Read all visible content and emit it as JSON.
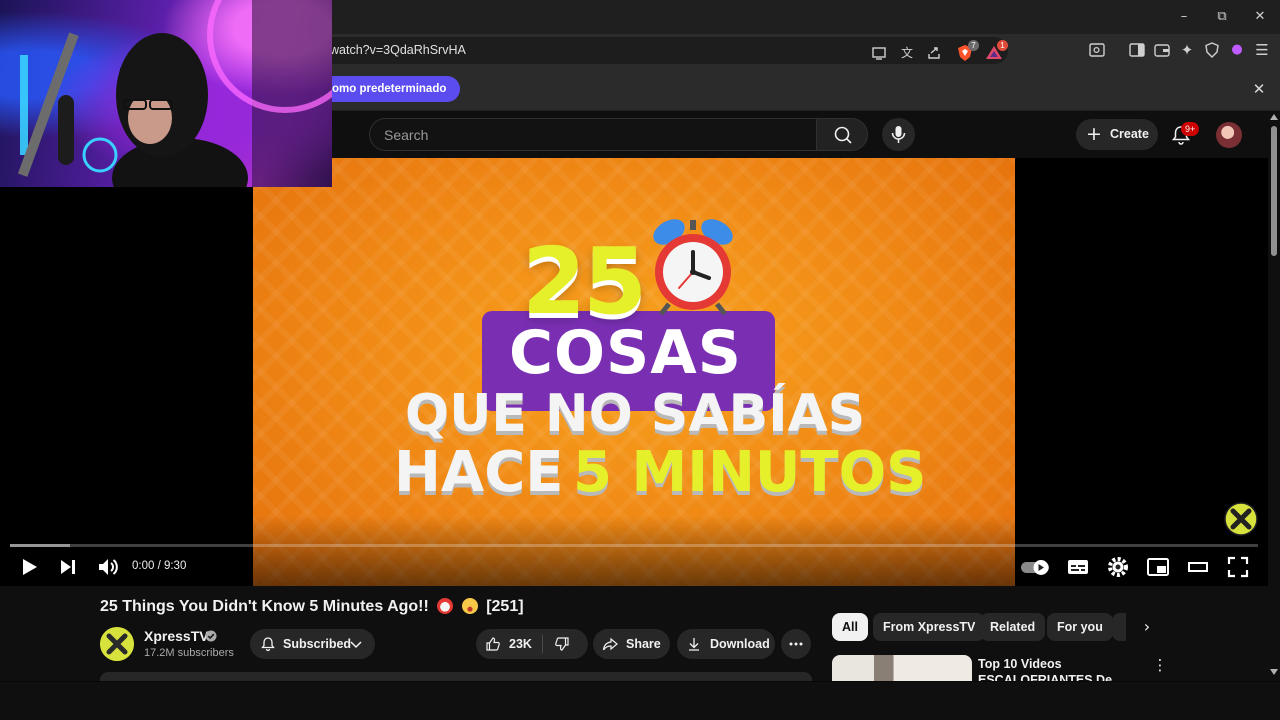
{
  "browser": {
    "url": "watch?v=3QdaRhSrvHA",
    "infobar_pill": "omo predeterminado",
    "brave_badge": "7",
    "rewards_badge": "1"
  },
  "youtube": {
    "search_placeholder": "Search",
    "create_label": "Create",
    "notifications_badge": "9+"
  },
  "player": {
    "time_display": "0:00 / 9:30",
    "played_fraction": 0.0,
    "buffered_fraction": 0.048,
    "thumbnail": {
      "number": "25",
      "line1": "COSAS",
      "line2": "QUE NO SABÍAS",
      "line3_prefix": "HACE",
      "line3_highlight": "5 MINUTOS"
    }
  },
  "video": {
    "title": "25 Things You Didn't Know 5 Minutes Ago!!",
    "title_tail": "[251]",
    "channel_name": "XpressTV",
    "subscribers": "17.2M subscribers",
    "subscribed_label": "Subscribed",
    "likes": "23K",
    "share_label": "Share",
    "download_label": "Download"
  },
  "sidebar": {
    "chips": [
      "All",
      "From XpressTV",
      "Related",
      "For you"
    ],
    "active_chip": "All",
    "recommendation_title": "Top 10 Videos ESCALOFRIANTES De"
  },
  "colors": {
    "accent_red": "#ff0000",
    "infobar_pill": "#5b4cf0",
    "thumb_orange": "#f18c16",
    "thumb_yellow": "#e5f02a",
    "thumb_purple": "#7a2fb3"
  }
}
